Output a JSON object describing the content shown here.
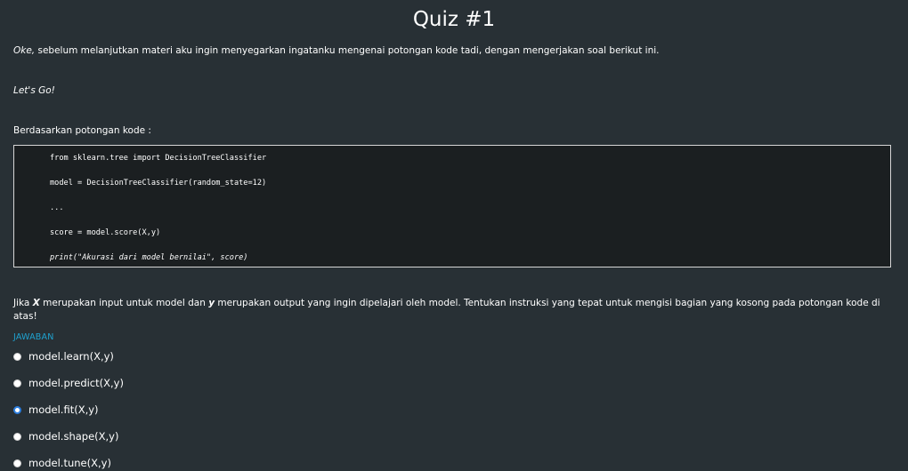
{
  "quiz": {
    "title": "Quiz #1",
    "intro_lead": "Oke,",
    "intro_rest": " sebelum melanjutkan materi aku ingin menyegarkan ingatanku mengenai potongan kode tadi, dengan mengerjakan soal berikut ini.",
    "lets_go": "Let's Go!",
    "based_on": "Berdasarkan potongan kode :"
  },
  "code": {
    "lines": [
      "from sklearn.tree import DecisionTreeClassifier",
      "model = DecisionTreeClassifier(random_state=12)",
      "...",
      "score = model.score(X,y)",
      "print(\"Akurasi dari model bernilai\", score)"
    ]
  },
  "question": {
    "part1": "Jika ",
    "var_x": "X",
    "part2": " merupakan input untuk model dan ",
    "var_y": "y",
    "part3": " merupakan output yang ingin dipelajari oleh model. Tentukan instruksi yang tepat untuk mengisi bagian yang kosong pada potongan kode di atas!"
  },
  "answer": {
    "label": "JAWABAN",
    "selected_index": 2,
    "options": [
      "model.learn(X,y)",
      "model.predict(X,y)",
      "model.fit(X,y)",
      "model.shape(X,y)",
      "model.tune(X,y)"
    ]
  },
  "colors": {
    "background": "#283035",
    "code_background": "#1b1f21",
    "accent": "#1fa3d1",
    "radio_selected": "#2d7fe0"
  }
}
